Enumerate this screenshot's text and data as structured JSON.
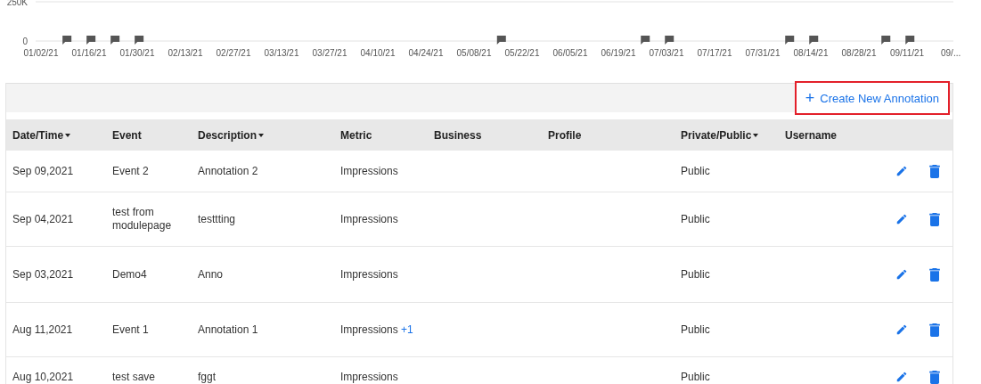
{
  "chart": {
    "chart_data": {
      "type": "line",
      "x": [
        "01/02/21",
        "01/16/21",
        "01/30/21",
        "02/13/21",
        "02/27/21",
        "03/13/21",
        "03/27/21",
        "04/10/21",
        "04/24/21",
        "05/08/21",
        "05/22/21",
        "06/05/21",
        "06/19/21",
        "07/03/21",
        "07/17/21",
        "07/31/21",
        "08/14/21",
        "08/28/21",
        "09/11/21",
        "09/..."
      ],
      "ylim": [
        0,
        250000
      ],
      "yticks": [
        {
          "value": 0,
          "label": "0"
        },
        {
          "value": 250000,
          "label": "250K"
        }
      ]
    }
  },
  "toolbar": {
    "create_button": {
      "icon": "+",
      "label": "Create New Annotation",
      "highlighted": true
    }
  },
  "table": {
    "columns": [
      {
        "label": "Date/Time",
        "sortable": true
      },
      {
        "label": "Event",
        "sortable": false
      },
      {
        "label": "Description",
        "sortable": true
      },
      {
        "label": "Metric",
        "sortable": false
      },
      {
        "label": "Business",
        "sortable": false
      },
      {
        "label": "Profile",
        "sortable": false
      },
      {
        "label": "Private/Public",
        "sortable": true
      },
      {
        "label": "Username",
        "sortable": false
      }
    ],
    "rows": [
      {
        "date": "Sep 09,2021",
        "event": "Event 2",
        "description": "Annotation 2",
        "metric": "Impressions",
        "visibility": "Public"
      },
      {
        "date": "Sep 04,2021",
        "event": "test from modulepage",
        "description": "testtting",
        "metric": "Impressions",
        "visibility": "Public"
      },
      {
        "date": "Sep 03,2021",
        "event": "Demo4",
        "description": "Anno",
        "metric": "Impressions",
        "visibility": "Public"
      },
      {
        "date": "Aug 11,2021",
        "event": "Event 1",
        "description": "Annotation 1",
        "metric": "Impressions",
        "metric_extra": "+1",
        "visibility": "Public"
      },
      {
        "date": "Aug 10,2021",
        "event": "test save",
        "description": "fggt",
        "metric": "Impressions",
        "visibility": "Public"
      }
    ]
  }
}
